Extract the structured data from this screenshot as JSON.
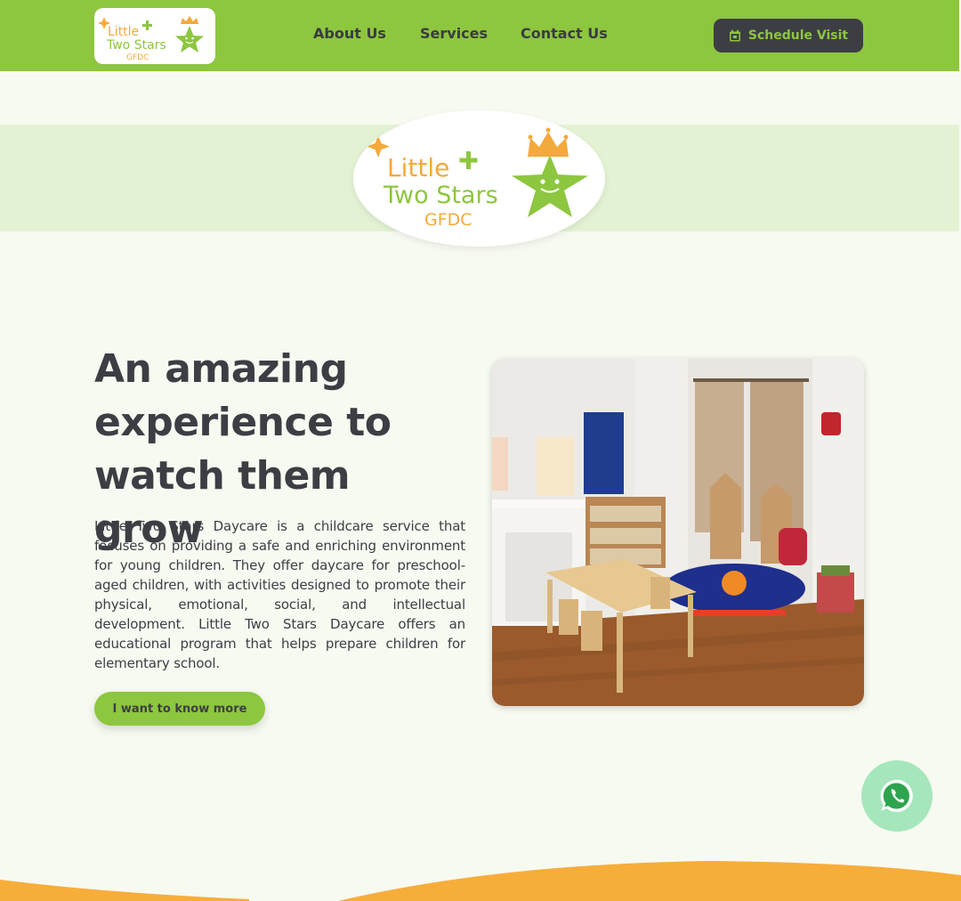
{
  "brand": {
    "line1": "Little",
    "line2": "Two Stars",
    "line3": "GFDC",
    "colors": {
      "green": "#8dc63f",
      "orange": "#f4a93b",
      "dark": "#3d3e44"
    }
  },
  "nav": {
    "items": [
      {
        "label": "About Us"
      },
      {
        "label": "Services"
      },
      {
        "label": "Contact Us"
      }
    ],
    "schedule_label": "Schedule Visit",
    "schedule_icon": "calendar-icon"
  },
  "hero": {
    "headline": "An amazing experience to watch them grow",
    "description": "Little Two Stars Daycare is a childcare service that focuses on providing a safe and enriching environment for young children. They offer daycare for preschool-aged children, with activities designed to promote their physical, emotional, social, and intellectual development. Little Two Stars Daycare offers an educational program that helps prepare children for elementary school.",
    "cta_label": "I want to know more"
  },
  "floating": {
    "icon": "whatsapp-icon"
  }
}
